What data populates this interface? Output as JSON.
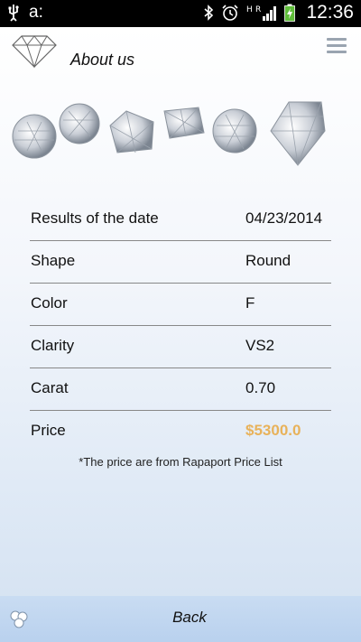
{
  "status_bar": {
    "left_icons": [
      "usb-icon",
      "a-icon"
    ],
    "left_text": "a:",
    "right_icons": [
      "bluetooth-icon",
      "alarm-icon",
      "hr-signal-icon",
      "signal-icon",
      "battery-icon"
    ],
    "time": "12:36"
  },
  "header": {
    "title": "About us",
    "logo": "diamond-logo",
    "menu_icon": "menu-icon"
  },
  "details": {
    "rows": [
      {
        "label": "Results of the date",
        "value": "04/23/2014"
      },
      {
        "label": "Shape",
        "value": "Round"
      },
      {
        "label": "Color",
        "value": "F"
      },
      {
        "label": "Clarity",
        "value": "VS2"
      },
      {
        "label": "Carat",
        "value": "0.70"
      },
      {
        "label": "Price",
        "value": "$5300.0"
      }
    ],
    "note": "*The price are from Rapaport Price List"
  },
  "bottom_bar": {
    "back_label": "Back",
    "icon": "gem-cluster-icon"
  },
  "colors": {
    "price_accent": "#e8b25a",
    "bottom_bar": "#c3d8f1",
    "status_bar": "#000000"
  }
}
